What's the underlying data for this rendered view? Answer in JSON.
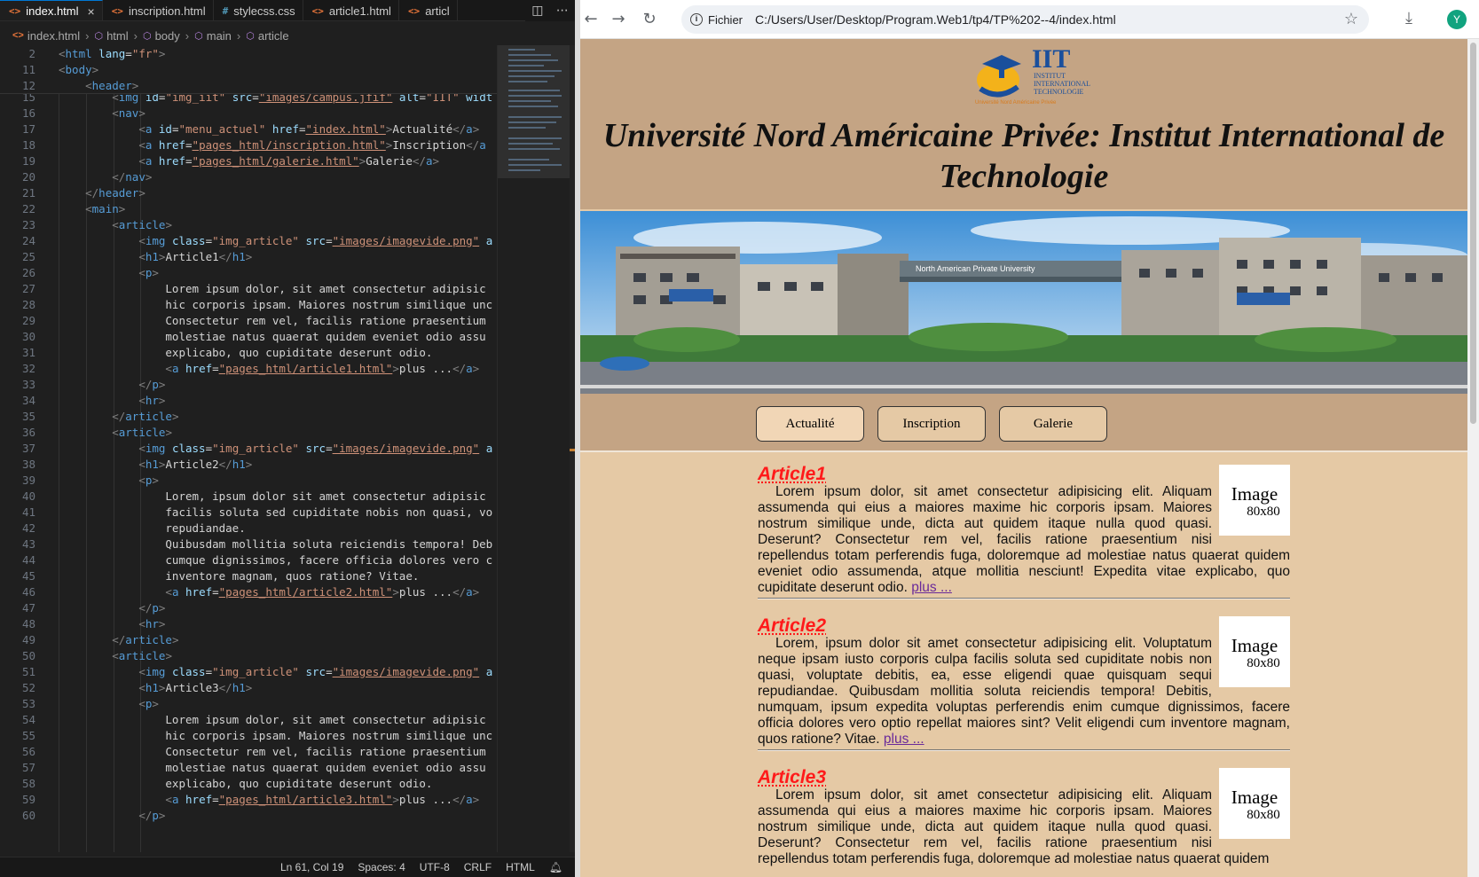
{
  "vscode": {
    "tabs": [
      {
        "icon": "<>",
        "label": "index.html",
        "active": true
      },
      {
        "icon": "<>",
        "label": "inscription.html"
      },
      {
        "icon": "#",
        "label": "stylecss.css"
      },
      {
        "icon": "<>",
        "label": "article1.html"
      },
      {
        "icon": "<>",
        "label": "articl"
      }
    ],
    "close_symbol": "×",
    "breadcrumb": [
      "index.html",
      "html",
      "body",
      "main",
      "article"
    ],
    "statusbar": {
      "position": "Ln 61, Col 19",
      "spaces": "Spaces: 4",
      "encoding": "UTF-8",
      "eol": "CRLF",
      "language": "HTML"
    }
  },
  "browser": {
    "chip": "Fichier",
    "url": "C:/Users/User/Desktop/Program.Web1/tp4/TP%202--4/index.html",
    "avatar": "Y",
    "icons": {
      "back": "back-arrow-icon",
      "forward": "forward-arrow-icon",
      "reload": "reload-icon",
      "star": "bookmark-star-icon",
      "download": "download-icon"
    }
  },
  "site": {
    "logo": {
      "big": "IIT",
      "line1": "INSTITUT",
      "line2": "INTERNATIONAL",
      "line3": "TECHNOLOGIE",
      "tag": "Université Nord Américaine Privée"
    },
    "title_line1": "Université Nord Américaine Privée: Institut International de",
    "title_line2": "Technologie",
    "campus_sign": "North American Private University",
    "nav": [
      "Actualité",
      "Inscription",
      "Galerie"
    ],
    "image_placeholder": {
      "line1": "Image",
      "line2": "80x80"
    },
    "articles": [
      {
        "title": "Article1",
        "text": "Lorem ipsum dolor, sit amet consectetur adipisicing elit. Aliquam assumenda qui eius a maiores maxime hic corporis ipsam. Maiores nostrum similique unde, dicta aut quidem itaque nulla quod quasi. Deserunt? Consectetur rem vel, facilis ratione praesentium nisi repellendus totam perferendis fuga, doloremque ad molestiae natus quaerat quidem eveniet odio assumenda, atque mollitia nesciunt! Expedita vitae explicabo, quo cupiditate deserunt odio.",
        "link": "plus ..."
      },
      {
        "title": "Article2",
        "text": "Lorem, ipsum dolor sit amet consectetur adipisicing elit. Voluptatum neque ipsam iusto corporis culpa facilis soluta sed cupiditate nobis non quasi, voluptate debitis, ea, esse eligendi quae quisquam sequi repudiandae. Quibusdam mollitia soluta reiciendis tempora! Debitis, numquam, ipsum expedita voluptas perferendis enim cumque dignissimos, facere officia dolores vero optio repellat maiores sint? Velit eligendi cum inventore magnam, quos ratione? Vitae.",
        "link": "plus ..."
      },
      {
        "title": "Article3",
        "text": "Lorem ipsum dolor, sit amet consectetur adipisicing elit. Aliquam assumenda qui eius a maiores maxime hic corporis ipsam. Maiores nostrum similique unde, dicta aut quidem itaque nulla quod quasi. Deserunt? Consectetur rem vel, facilis ratione praesentium nisi repellendus totam perferendis fuga, doloremque ad molestiae natus quaerat quidem",
        "link": ""
      }
    ]
  }
}
